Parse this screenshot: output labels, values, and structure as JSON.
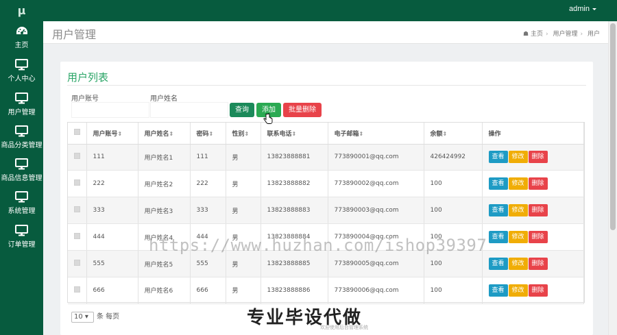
{
  "app": {
    "logo": "μ",
    "user": "admin"
  },
  "colors": {
    "primary": "#075b3e",
    "accent": "#28a465",
    "danger": "#e8434a",
    "info": "#1e9bc4",
    "warning": "#f0ad06"
  },
  "sidebar": {
    "items": [
      {
        "icon": "dashboard-icon",
        "label": "主页"
      },
      {
        "icon": "monitor-icon",
        "label": "个人中心"
      },
      {
        "icon": "monitor-icon",
        "label": "用户管理"
      },
      {
        "icon": "monitor-icon",
        "label": "商品分类管理"
      },
      {
        "icon": "monitor-icon",
        "label": "商品信息管理"
      },
      {
        "icon": "monitor-icon",
        "label": "系统管理"
      },
      {
        "icon": "monitor-icon",
        "label": "订单管理"
      }
    ]
  },
  "header": {
    "title": "用户管理",
    "breadcrumb": [
      "主页",
      "用户管理",
      "用户"
    ]
  },
  "panel": {
    "title": "用户列表",
    "filters": {
      "account_label": "用户账号",
      "name_label": "用户姓名",
      "account_value": "",
      "name_value": ""
    },
    "buttons": {
      "query": "查询",
      "add": "添加",
      "batch_delete": "批量删除"
    }
  },
  "table": {
    "columns": [
      "用户账号",
      "用户姓名",
      "密码",
      "性别",
      "联系电话",
      "电子邮箱",
      "余额",
      "操作"
    ],
    "rows": [
      {
        "account": "111",
        "name": "用户姓名1",
        "password": "111",
        "gender": "男",
        "phone": "13823888881",
        "email": "773890001@qq.com",
        "balance": "426424992"
      },
      {
        "account": "222",
        "name": "用户姓名2",
        "password": "222",
        "gender": "男",
        "phone": "13823888882",
        "email": "773890002@qq.com",
        "balance": "100"
      },
      {
        "account": "333",
        "name": "用户姓名3",
        "password": "333",
        "gender": "男",
        "phone": "13823888883",
        "email": "773890003@qq.com",
        "balance": "100"
      },
      {
        "account": "444",
        "name": "用户姓名4",
        "password": "444",
        "gender": "男",
        "phone": "13823888884",
        "email": "773890004@qq.com",
        "balance": "100"
      },
      {
        "account": "555",
        "name": "用户姓名5",
        "password": "555",
        "gender": "男",
        "phone": "13823888885",
        "email": "773890005@qq.com",
        "balance": "100"
      },
      {
        "account": "666",
        "name": "用户姓名6",
        "password": "666",
        "gender": "男",
        "phone": "13823888886",
        "email": "773890006@qq.com",
        "balance": "100"
      }
    ],
    "actions": {
      "view": "查看",
      "edit": "修改",
      "delete": "删除"
    }
  },
  "pagination": {
    "page_size": "10",
    "page_size_label": "条 每页"
  },
  "overlay": {
    "watermark": "https://www.huzhan.com/ishop39397",
    "banner": "专业毕设代做",
    "banner_sub": "欢迎使用后台管理系统"
  }
}
